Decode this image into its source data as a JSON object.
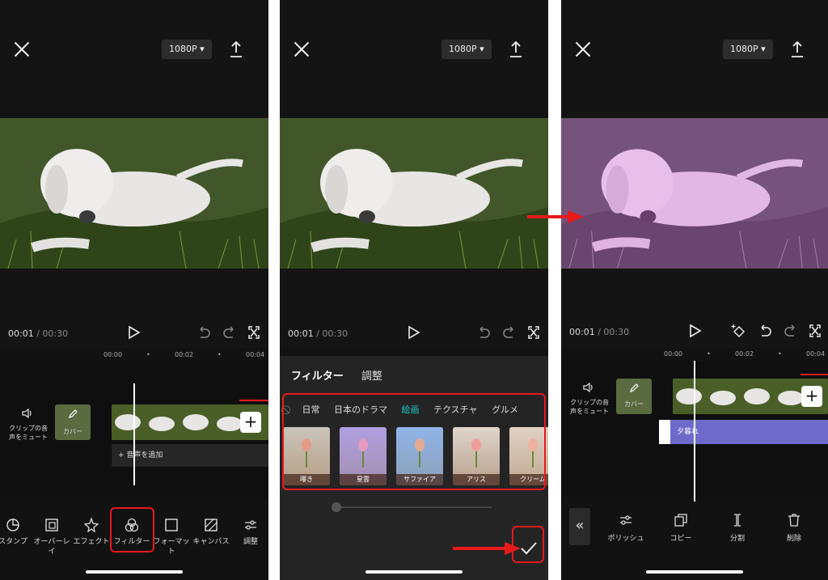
{
  "resolution": "1080P ▾",
  "time": {
    "current": "00:01",
    "sep": " / ",
    "total": "00:30"
  },
  "ruler": [
    "00:00",
    "•",
    "00:02",
    "•",
    "00:04"
  ],
  "mute_label": "クリップの音\n声をミュート",
  "cover_label": "カバー",
  "add_audio": "+ 音声を追加",
  "screen1_tools": [
    "スタンプ",
    "オーバーレ\nイ",
    "エフェクト",
    "フィルター",
    "フォーマッ\nト",
    "キャンバス",
    "調整"
  ],
  "filter_tabs": [
    "フィルター",
    "調整"
  ],
  "filter_cats": [
    "日常",
    "日本のドラマ",
    "絵画",
    "テクスチャ",
    "グルメ"
  ],
  "filter_cat_selected": "絵画",
  "filter_items": [
    "曝き",
    "星雲",
    "サファイア",
    "アリス",
    "クリーム"
  ],
  "effect_name": "夕暮れ",
  "screen3_tools": [
    "ポリッシュ",
    "コピー",
    "分割",
    "削除"
  ],
  "colors": {
    "highlight": "#e8191b",
    "accent": "#21c5c5",
    "effect": "#6e6acb"
  }
}
